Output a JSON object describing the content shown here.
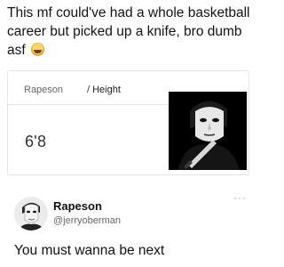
{
  "caption": {
    "text": "This mf could've had a whole basketball career but picked up a knife, bro dumb asf",
    "emoji_icon": "rolling-on-floor-laughing-emoji"
  },
  "card": {
    "breadcrumb_name": "Rapeson",
    "breadcrumb_separator": "/",
    "breadcrumb_attribute": "Height",
    "value": "6'8",
    "image_icon": "masked-figure-with-knife"
  },
  "tweet": {
    "display_name": "Rapeson",
    "handle": "@jerryoberman",
    "more_label": "···",
    "text": "You must wanna be next",
    "avatar_icon": "masked-figure-avatar"
  }
}
